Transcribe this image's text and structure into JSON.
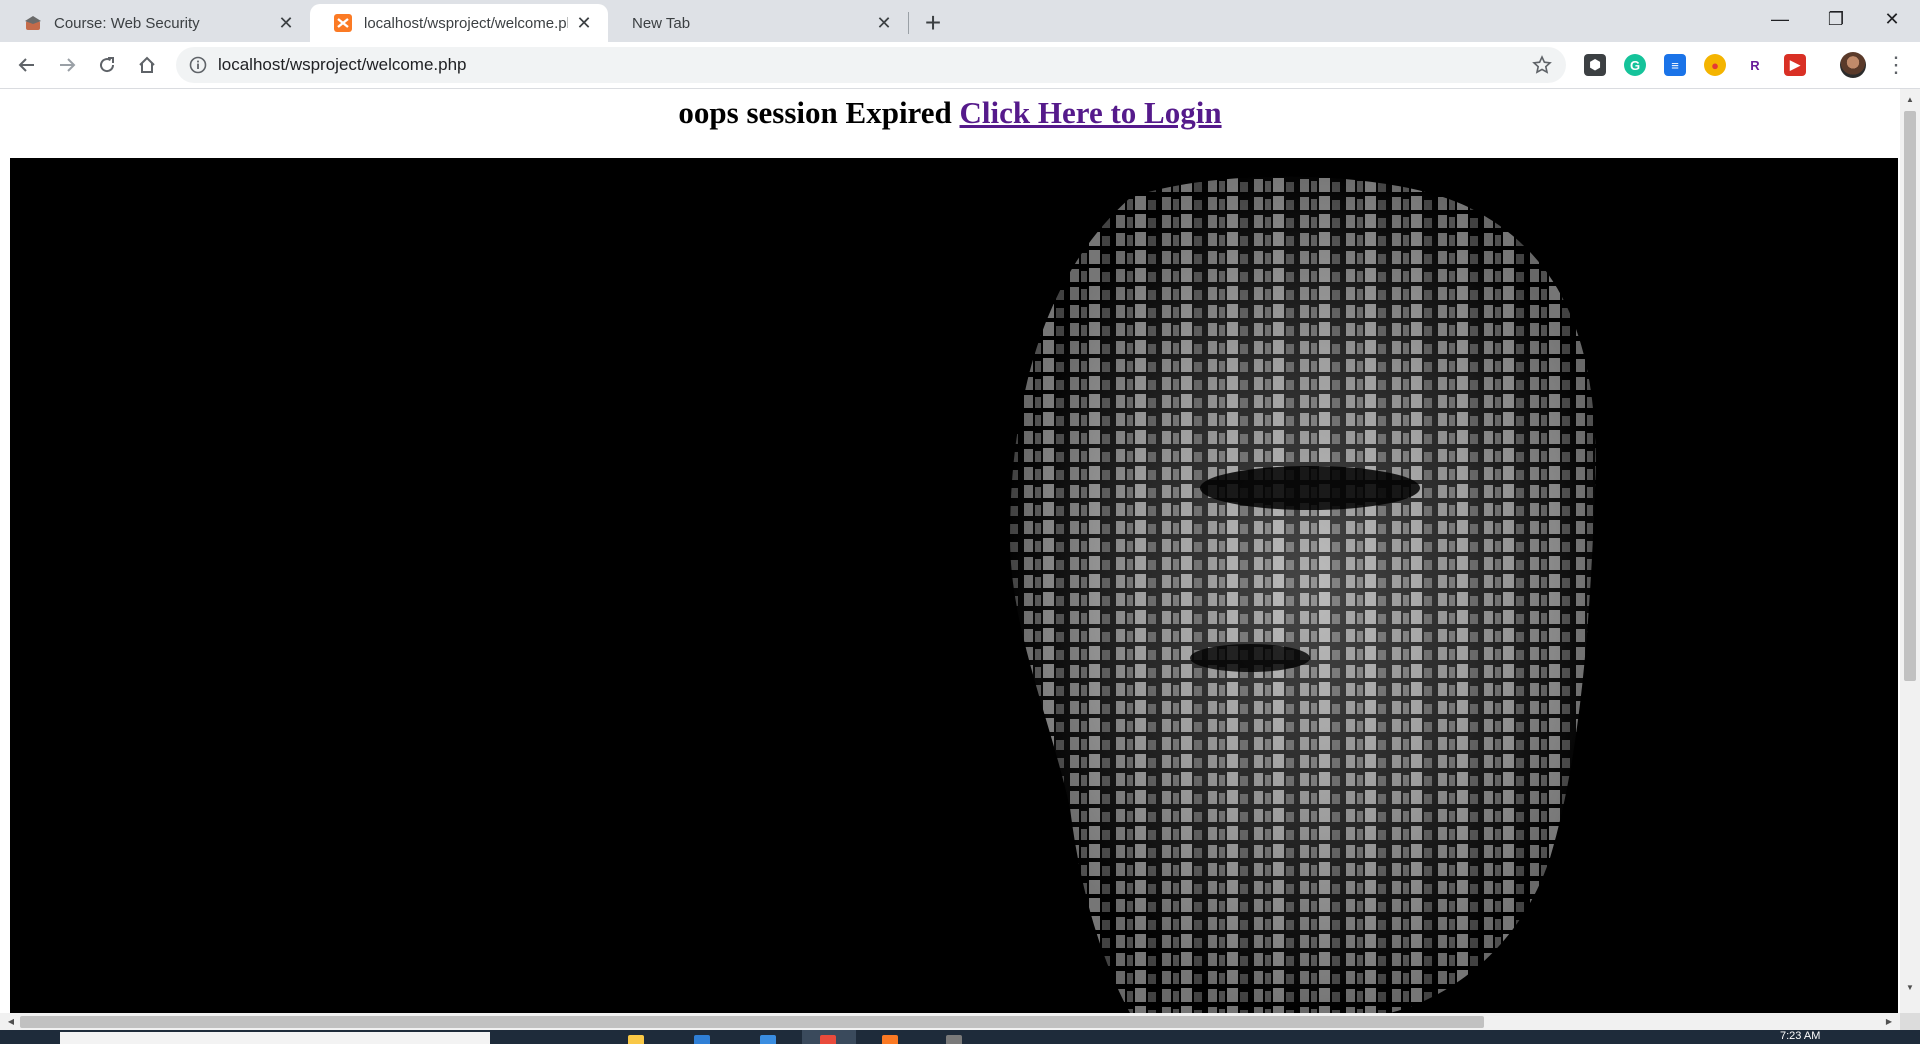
{
  "browser": {
    "tabs": [
      {
        "title": "Course: Web Security",
        "active": false,
        "favicon": "moodle-hat-icon"
      },
      {
        "title": "localhost/wsproject/welcome.php",
        "active": true,
        "favicon": "xampp-icon"
      },
      {
        "title": "New Tab",
        "active": false,
        "favicon": ""
      }
    ],
    "close_glyph": "✕",
    "new_tab_glyph": "+",
    "window_controls": {
      "minimize": "—",
      "maximize": "❐",
      "close": "✕"
    },
    "address_bar": {
      "url": "localhost/wsproject/welcome.php"
    },
    "extensions": [
      {
        "name": "password-manager-icon",
        "color": "#3c4043",
        "glyph": "⬢"
      },
      {
        "name": "grammarly-icon",
        "color": "#15c39a",
        "glyph": "G"
      },
      {
        "name": "reader-icon",
        "color": "#1a73e8",
        "glyph": "≡"
      },
      {
        "name": "palette-icon",
        "color": "#f4b400",
        "glyph": "●"
      },
      {
        "name": "r-extension-icon",
        "color": "#ffffff",
        "glyph": "R"
      },
      {
        "name": "video-extension-icon",
        "color": "#d93025",
        "glyph": "▶"
      }
    ]
  },
  "page": {
    "message": "oops session Expired",
    "login_link": "Click Here to Login"
  },
  "taskbar": {
    "clock": "7:23 AM"
  }
}
